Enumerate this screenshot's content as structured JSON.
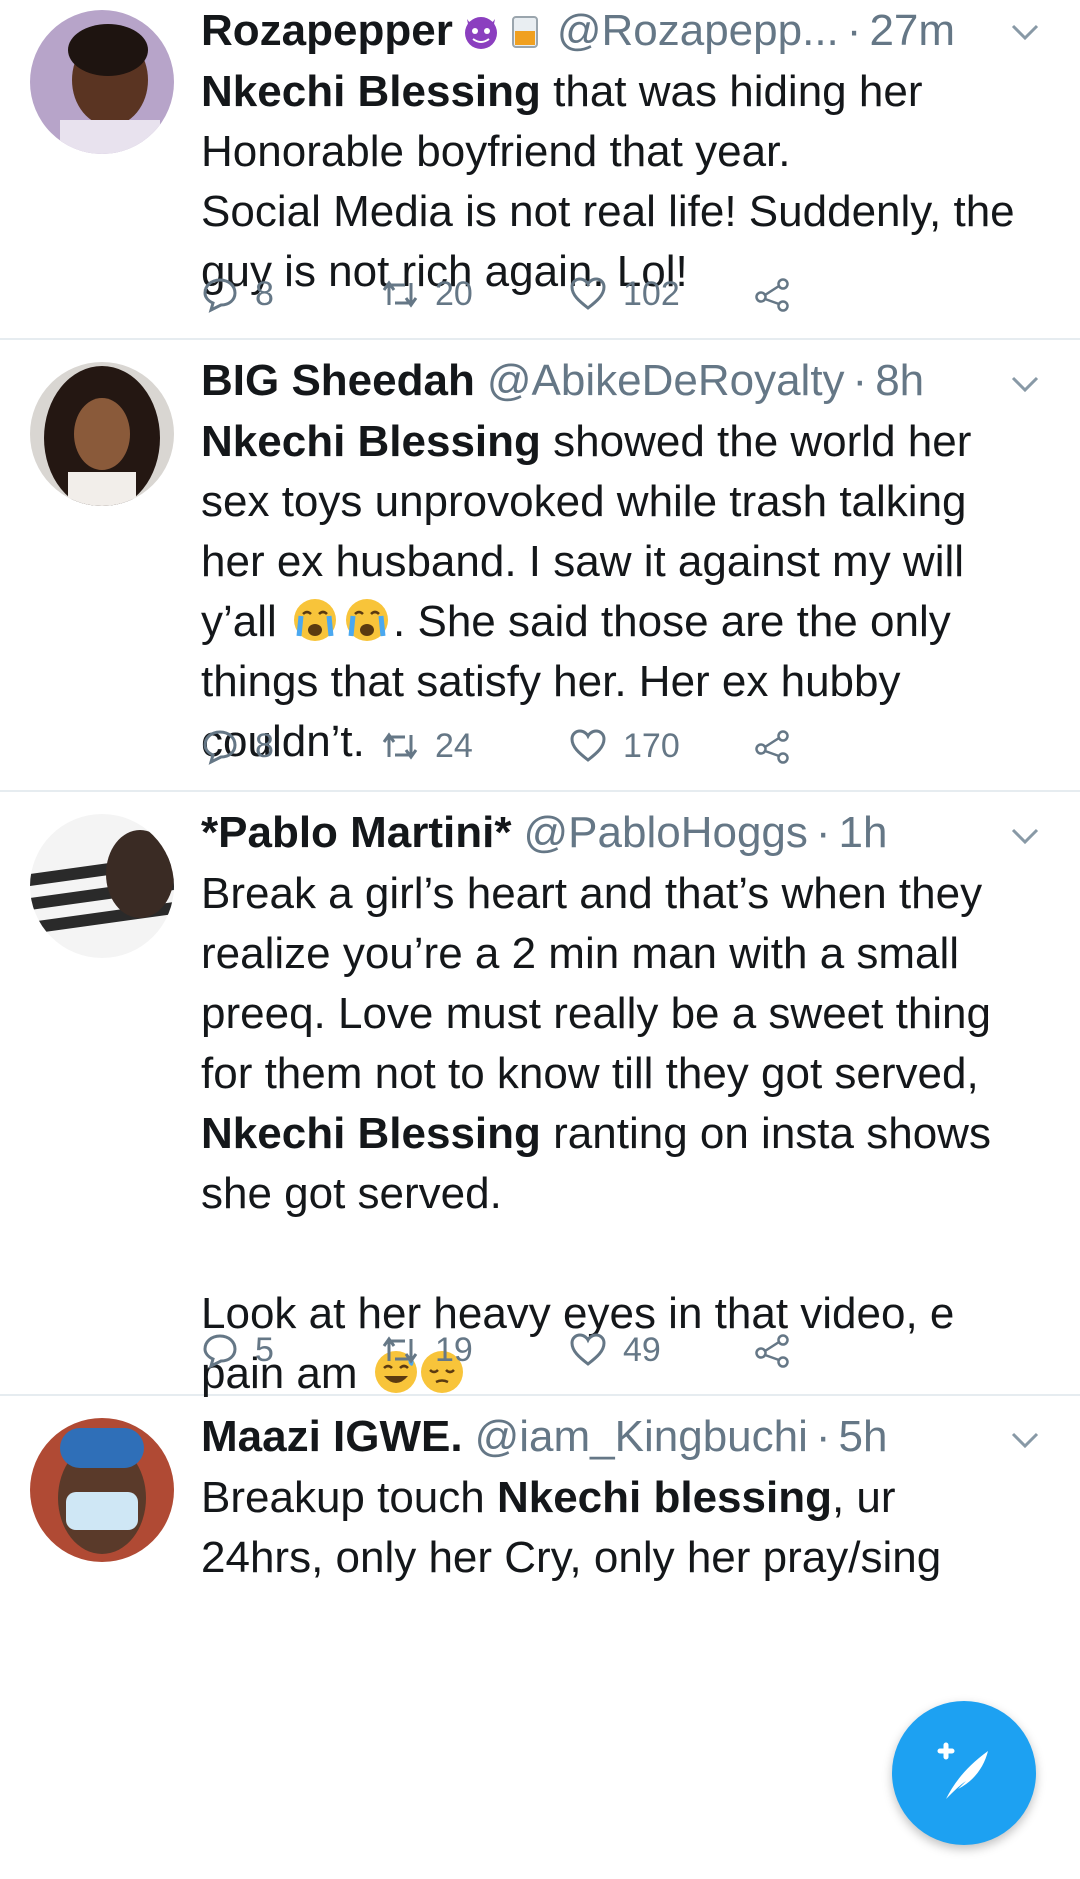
{
  "tweets": [
    {
      "name": "Rozapepper",
      "handle": "@Rozapepp...",
      "sep": "·",
      "time": "27m",
      "text_bold": "Nkechi Blessing",
      "text_rest1": " that was hiding her",
      "text_line2": "Honorable boyfriend that year.",
      "text_line3": "Social Media is not real life! Suddenly, the",
      "text_line4": "guy is not rich again. Lol!",
      "reply_count": "8",
      "retweet_count": "20",
      "like_count": "102"
    },
    {
      "name": "BIG Sheedah",
      "handle": "@AbikeDeRoyalty",
      "sep": "·",
      "time": "8h",
      "text_bold": "Nkechi Blessing",
      "text_rest1": " showed the world her",
      "text_line2": "sex toys unprovoked while trash talking",
      "text_line3": "her ex husband. I saw it against my will",
      "text_line4a": "y’all ",
      "text_line4b": ". She said those are the only",
      "text_line5": "things that satisfy her. Her ex hubby",
      "text_line6": "couldn’t.",
      "reply_count": "8",
      "retweet_count": "24",
      "like_count": "170"
    },
    {
      "name": "*Pablo Martini*",
      "handle": "@PabloHoggs",
      "sep": "·",
      "time": "1h",
      "text_line1": "Break a girl’s heart and that’s when they",
      "text_line2": "realize you’re a 2 min man with a small",
      "text_line3": "preeq. Love must really be a sweet thing",
      "text_line4": "for them not to know till they got served,",
      "text_bold": "Nkechi Blessing",
      "text_rest5": " ranting on insta shows",
      "text_line6": "she got served.",
      "text_line7": "Look at her heavy eyes in that video, e",
      "text_line8": "pain am ",
      "reply_count": "5",
      "retweet_count": "19",
      "like_count": "49"
    },
    {
      "name": "Maazi IGWE.",
      "handle": "@iam_Kingbuchi",
      "sep": "·",
      "time": "5h",
      "text_pre": "Breakup touch ",
      "text_bold": "Nkechi blessing",
      "text_rest1": ", ur",
      "text_line2": "24hrs, only her Cry, only her pray/sing"
    }
  ],
  "icons": {
    "reply": "reply-icon",
    "retweet": "retweet-icon",
    "like": "heart-icon",
    "share": "share-icon",
    "more": "chevron-down-icon",
    "compose": "compose-tweet-icon"
  },
  "colors": {
    "accent": "#1da1f2",
    "secondary_text": "#657786",
    "divider": "#e6ecf0"
  }
}
